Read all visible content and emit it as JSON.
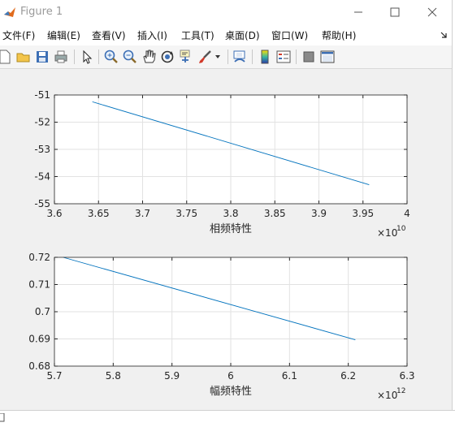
{
  "window": {
    "title": "Figure 1"
  },
  "menu": [
    "文件(F)",
    "编辑(E)",
    "查看(V)",
    "插入(I)",
    "工具(T)",
    "桌面(D)",
    "窗口(W)",
    "帮助(H)"
  ],
  "toolbar": [
    {
      "name": "new-figure-icon"
    },
    {
      "name": "open-file-icon"
    },
    {
      "name": "save-icon"
    },
    {
      "name": "print-icon"
    },
    {
      "name": "select-arrow-icon"
    },
    {
      "name": "zoom-in-icon"
    },
    {
      "name": "zoom-out-icon"
    },
    {
      "name": "pan-hand-icon"
    },
    {
      "name": "rotate-3d-icon"
    },
    {
      "name": "data-cursor-icon"
    },
    {
      "name": "brush-icon"
    },
    {
      "name": "link-plot-icon"
    },
    {
      "name": "colorbar-icon"
    },
    {
      "name": "legend-icon"
    },
    {
      "name": "hide-plot-tools-icon"
    },
    {
      "name": "show-plot-tools-icon"
    }
  ],
  "chart_data": [
    {
      "type": "line",
      "xlabel": "相频特性",
      "x_exponent": "10",
      "xlim": [
        3.6,
        4
      ],
      "ylim": [
        -55,
        -51
      ],
      "xticks": [
        "3.6",
        "3.65",
        "3.7",
        "3.75",
        "3.8",
        "3.85",
        "3.9",
        "3.95",
        "4"
      ],
      "yticks": [
        "-51",
        "-52",
        "-53",
        "-54",
        "-55"
      ],
      "grid": true,
      "series": [
        {
          "x": [
            3.643,
            3.957
          ],
          "y": [
            -51.25,
            -54.3
          ],
          "color": "#0072bd"
        }
      ]
    },
    {
      "type": "line",
      "xlabel": "幅频特性",
      "x_exponent": "12",
      "xlim": [
        5.7,
        6.3
      ],
      "ylim": [
        0.68,
        0.72
      ],
      "xticks": [
        "5.7",
        "5.8",
        "5.9",
        "6",
        "6.1",
        "6.2",
        "6.3"
      ],
      "yticks": [
        "0.72",
        "0.71",
        "0.7",
        "0.69",
        "0.68"
      ],
      "grid": true,
      "series": [
        {
          "x": [
            5.715,
            6.212
          ],
          "y": [
            0.72,
            0.6897
          ],
          "color": "#0072bd"
        }
      ]
    }
  ]
}
